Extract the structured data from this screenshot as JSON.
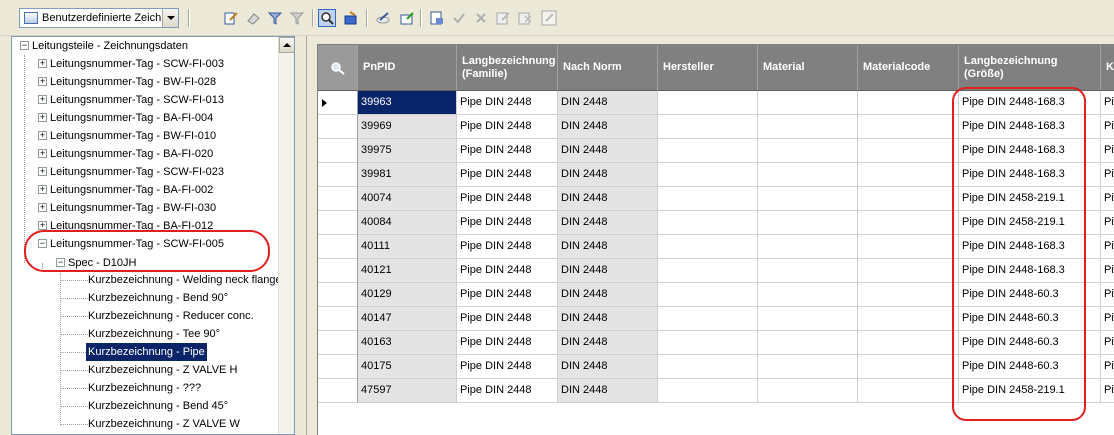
{
  "toolbar": {
    "view_select_value": "Benutzerdefinierte Zeich",
    "icons": [
      "edit-icon",
      "erase-icon",
      "filter-icon",
      "clear-filter-icon",
      "zoom-icon",
      "export-icon",
      "edit-pen-icon",
      "import-icon",
      "properties-icon",
      "accept-icon",
      "reject-icon",
      "edit-list-icon",
      "check-list-icon",
      "edit-multi-icon"
    ]
  },
  "tree": {
    "root": "Leitungsteile - Zeichnungsdaten",
    "items": [
      "Leitungsnummer-Tag - SCW-FI-003",
      "Leitungsnummer-Tag - BW-FI-028",
      "Leitungsnummer-Tag - SCW-FI-013",
      "Leitungsnummer-Tag - BA-FI-004",
      "Leitungsnummer-Tag - BW-FI-010",
      "Leitungsnummer-Tag - BA-FI-020",
      "Leitungsnummer-Tag - SCW-FI-023",
      "Leitungsnummer-Tag - BA-FI-002",
      "Leitungsnummer-Tag - BW-FI-030",
      "Leitungsnummer-Tag - BA-FI-012",
      "Leitungsnummer-Tag - SCW-FI-005"
    ],
    "spec": "Spec - D10JH",
    "leaves": [
      "Kurzbezeichnung - Welding neck flange",
      "Kurzbezeichnung - Bend 90°",
      "Kurzbezeichnung - Reducer conc.",
      "Kurzbezeichnung - Tee 90°",
      "Kurzbezeichnung - Pipe",
      "Kurzbezeichnung - Z VALVE H",
      "Kurzbezeichnung - ???",
      "Kurzbezeichnung - Bend 45°",
      "Kurzbezeichnung - Z VALVE W"
    ]
  },
  "grid": {
    "columns": [
      {
        "label": "PnPID"
      },
      {
        "label": "Langbezeichnung (Familie)"
      },
      {
        "label": "Nach Norm"
      },
      {
        "label": "Hersteller"
      },
      {
        "label": "Material"
      },
      {
        "label": "Materialcode"
      },
      {
        "label": "Langbezeichnung (Größe)"
      },
      {
        "label": "K"
      }
    ],
    "rows": [
      [
        "39963",
        "Pipe DIN 2448",
        "DIN 2448",
        "",
        "",
        "",
        "Pipe DIN 2448-168.3",
        "Pip"
      ],
      [
        "39969",
        "Pipe DIN 2448",
        "DIN 2448",
        "",
        "",
        "",
        "Pipe DIN 2448-168.3",
        "Pip"
      ],
      [
        "39975",
        "Pipe DIN 2448",
        "DIN 2448",
        "",
        "",
        "",
        "Pipe DIN 2448-168.3",
        "Pip"
      ],
      [
        "39981",
        "Pipe DIN 2448",
        "DIN 2448",
        "",
        "",
        "",
        "Pipe DIN 2448-168.3",
        "Pip"
      ],
      [
        "40074",
        "Pipe DIN 2448",
        "DIN 2448",
        "",
        "",
        "",
        "Pipe DIN 2458-219.1",
        "Pip"
      ],
      [
        "40084",
        "Pipe DIN 2448",
        "DIN 2448",
        "",
        "",
        "",
        "Pipe DIN 2458-219.1",
        "Pip"
      ],
      [
        "40111",
        "Pipe DIN 2448",
        "DIN 2448",
        "",
        "",
        "",
        "Pipe DIN 2448-168.3",
        "Pip"
      ],
      [
        "40121",
        "Pipe DIN 2448",
        "DIN 2448",
        "",
        "",
        "",
        "Pipe DIN 2448-168.3",
        "Pip"
      ],
      [
        "40129",
        "Pipe DIN 2448",
        "DIN 2448",
        "",
        "",
        "",
        "Pipe DIN 2448-60.3",
        "Pip"
      ],
      [
        "40147",
        "Pipe DIN 2448",
        "DIN 2448",
        "",
        "",
        "",
        "Pipe DIN 2448-60.3",
        "Pip"
      ],
      [
        "40163",
        "Pipe DIN 2448",
        "DIN 2448",
        "",
        "",
        "",
        "Pipe DIN 2448-60.3",
        "Pip"
      ],
      [
        "40175",
        "Pipe DIN 2448",
        "DIN 2448",
        "",
        "",
        "",
        "Pipe DIN 2448-60.3",
        "Pip"
      ],
      [
        "47597",
        "Pipe DIN 2448",
        "DIN 2448",
        "",
        "",
        "",
        "Pipe DIN 2458-219.1",
        "Pip"
      ]
    ]
  },
  "colors": {
    "annotation": "#e02020",
    "selection": "#0a246a",
    "header": "#808080"
  }
}
